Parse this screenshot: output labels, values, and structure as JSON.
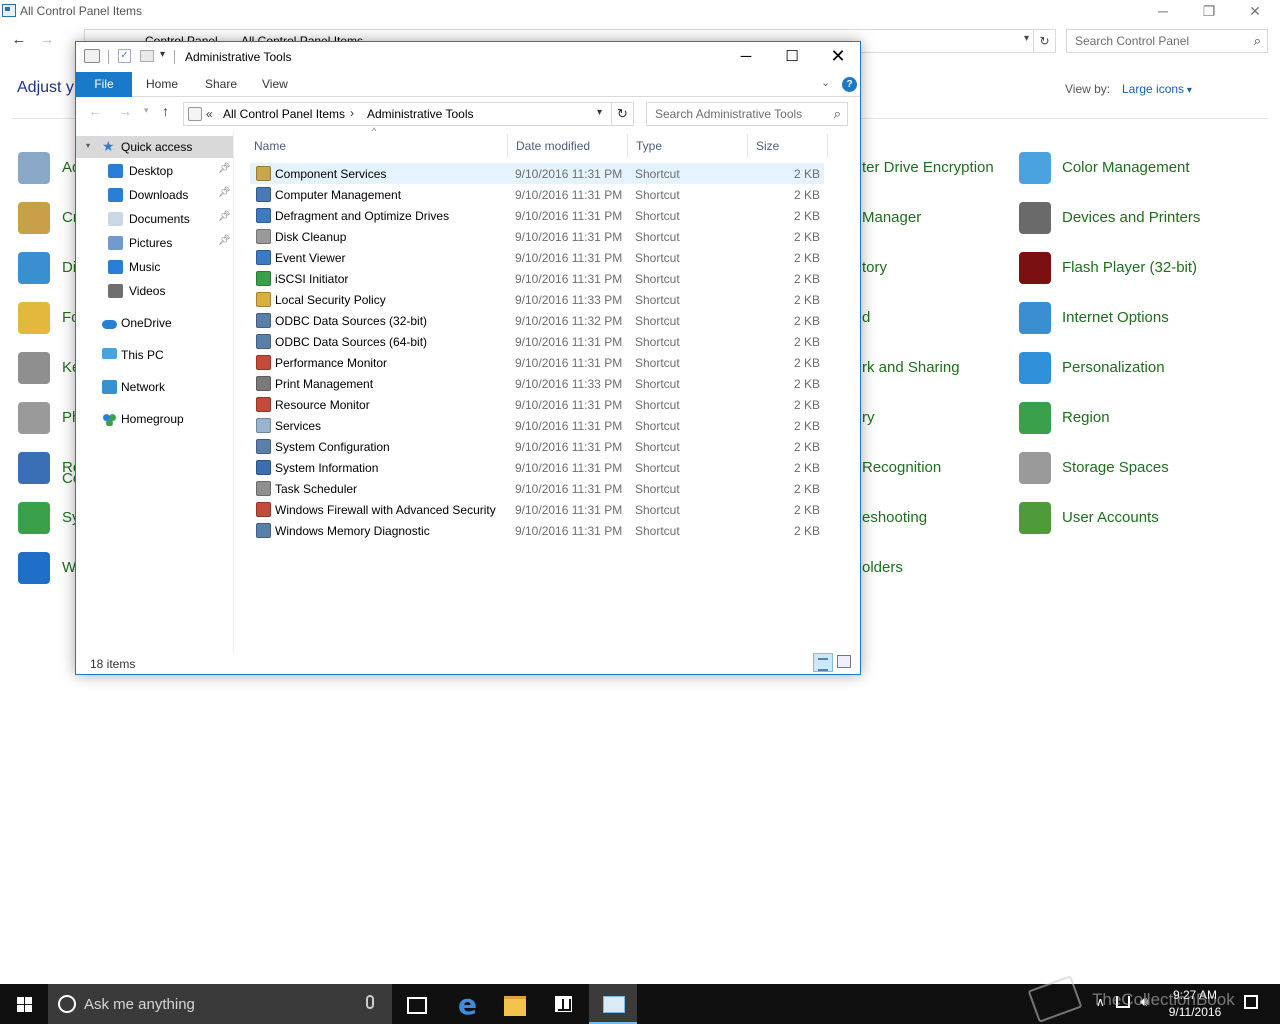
{
  "control_panel": {
    "title": "All Control Panel Items",
    "breadcrumbs": [
      "Control Panel",
      "All Control Panel Items"
    ],
    "search_placeholder": "Search Control Panel",
    "heading": "Adjust y",
    "view_by_label": "View by:",
    "view_by_value": "Large icons",
    "left_fragments": [
      "Ad",
      "Cr",
      "Di",
      "Fo",
      "Ke",
      "Ph",
      "Re",
      "Co",
      "Sy",
      "W"
    ],
    "middle_fragments": [
      "ter Drive Encryption",
      "Manager",
      "tory",
      "d",
      "rk and Sharing",
      "ry",
      "Recognition",
      "eshooting",
      "olders"
    ],
    "right_items": [
      {
        "label": "Color Management",
        "icon": "color-management-icon",
        "color": "#4aa3df"
      },
      {
        "label": "Devices and Printers",
        "icon": "devices-printers-icon",
        "color": "#6a6a6a"
      },
      {
        "label": "Flash Player (32-bit)",
        "icon": "flash-player-icon",
        "color": "#7a1010"
      },
      {
        "label": "Internet Options",
        "icon": "internet-options-icon",
        "color": "#3a8fd0"
      },
      {
        "label": "Personalization",
        "icon": "personalization-icon",
        "color": "#2f8fd8"
      },
      {
        "label": "Region",
        "icon": "region-icon",
        "color": "#3aa04a"
      },
      {
        "label": "Storage Spaces",
        "icon": "storage-spaces-icon",
        "color": "#9a9a9a"
      },
      {
        "label": "User Accounts",
        "icon": "user-accounts-icon",
        "color": "#4f9a3a"
      }
    ]
  },
  "explorer": {
    "title": "Administrative Tools",
    "ribbon_tabs": {
      "file": "File",
      "home": "Home",
      "share": "Share",
      "view": "View"
    },
    "help_label": "?",
    "address": {
      "lt": "«",
      "crumb1": "All Control Panel Items",
      "sep": "›",
      "crumb2": "Administrative Tools"
    },
    "search_placeholder": "Search Administrative Tools",
    "nav": {
      "quick_access": "Quick access",
      "pinned": [
        "Desktop",
        "Downloads",
        "Documents",
        "Pictures"
      ],
      "unpinned": [
        "Music",
        "Videos"
      ],
      "onedrive": "OneDrive",
      "this_pc": "This PC",
      "network": "Network",
      "homegroup": "Homegroup"
    },
    "columns": {
      "name": "Name",
      "date": "Date modified",
      "type": "Type",
      "size": "Size"
    },
    "files": [
      {
        "name": "Component Services",
        "date": "9/10/2016 11:31 PM",
        "type": "Shortcut",
        "size": "2 KB",
        "icon": "component-services-icon"
      },
      {
        "name": "Computer Management",
        "date": "9/10/2016 11:31 PM",
        "type": "Shortcut",
        "size": "2 KB",
        "icon": "computer-management-icon"
      },
      {
        "name": "Defragment and Optimize Drives",
        "date": "9/10/2016 11:31 PM",
        "type": "Shortcut",
        "size": "2 KB",
        "icon": "defragment-icon"
      },
      {
        "name": "Disk Cleanup",
        "date": "9/10/2016 11:31 PM",
        "type": "Shortcut",
        "size": "2 KB",
        "icon": "disk-cleanup-icon"
      },
      {
        "name": "Event Viewer",
        "date": "9/10/2016 11:31 PM",
        "type": "Shortcut",
        "size": "2 KB",
        "icon": "event-viewer-icon"
      },
      {
        "name": "iSCSI Initiator",
        "date": "9/10/2016 11:31 PM",
        "type": "Shortcut",
        "size": "2 KB",
        "icon": "iscsi-initiator-icon"
      },
      {
        "name": "Local Security Policy",
        "date": "9/10/2016 11:33 PM",
        "type": "Shortcut",
        "size": "2 KB",
        "icon": "local-security-policy-icon"
      },
      {
        "name": "ODBC Data Sources (32-bit)",
        "date": "9/10/2016 11:32 PM",
        "type": "Shortcut",
        "size": "2 KB",
        "icon": "odbc-icon"
      },
      {
        "name": "ODBC Data Sources (64-bit)",
        "date": "9/10/2016 11:31 PM",
        "type": "Shortcut",
        "size": "2 KB",
        "icon": "odbc-icon"
      },
      {
        "name": "Performance Monitor",
        "date": "9/10/2016 11:31 PM",
        "type": "Shortcut",
        "size": "2 KB",
        "icon": "performance-monitor-icon"
      },
      {
        "name": "Print Management",
        "date": "9/10/2016 11:33 PM",
        "type": "Shortcut",
        "size": "2 KB",
        "icon": "print-management-icon"
      },
      {
        "name": "Resource Monitor",
        "date": "9/10/2016 11:31 PM",
        "type": "Shortcut",
        "size": "2 KB",
        "icon": "resource-monitor-icon"
      },
      {
        "name": "Services",
        "date": "9/10/2016 11:31 PM",
        "type": "Shortcut",
        "size": "2 KB",
        "icon": "services-icon"
      },
      {
        "name": "System Configuration",
        "date": "9/10/2016 11:31 PM",
        "type": "Shortcut",
        "size": "2 KB",
        "icon": "system-configuration-icon"
      },
      {
        "name": "System Information",
        "date": "9/10/2016 11:31 PM",
        "type": "Shortcut",
        "size": "2 KB",
        "icon": "system-information-icon"
      },
      {
        "name": "Task Scheduler",
        "date": "9/10/2016 11:31 PM",
        "type": "Shortcut",
        "size": "2 KB",
        "icon": "task-scheduler-icon"
      },
      {
        "name": "Windows Firewall with Advanced Security",
        "date": "9/10/2016 11:31 PM",
        "type": "Shortcut",
        "size": "2 KB",
        "icon": "windows-firewall-icon"
      },
      {
        "name": "Windows Memory Diagnostic",
        "date": "9/10/2016 11:31 PM",
        "type": "Shortcut",
        "size": "2 KB",
        "icon": "memory-diagnostic-icon"
      }
    ],
    "item_count": "18 items"
  },
  "taskbar": {
    "search_placeholder": "Ask me anything",
    "time": "9:27 AM",
    "date": "9/11/2016",
    "watermark": "TheCollectionBook"
  },
  "colors": {
    "accent": "#1979ca",
    "cp_link_green": "#1e6e1e",
    "selection": "#cce8ff"
  }
}
